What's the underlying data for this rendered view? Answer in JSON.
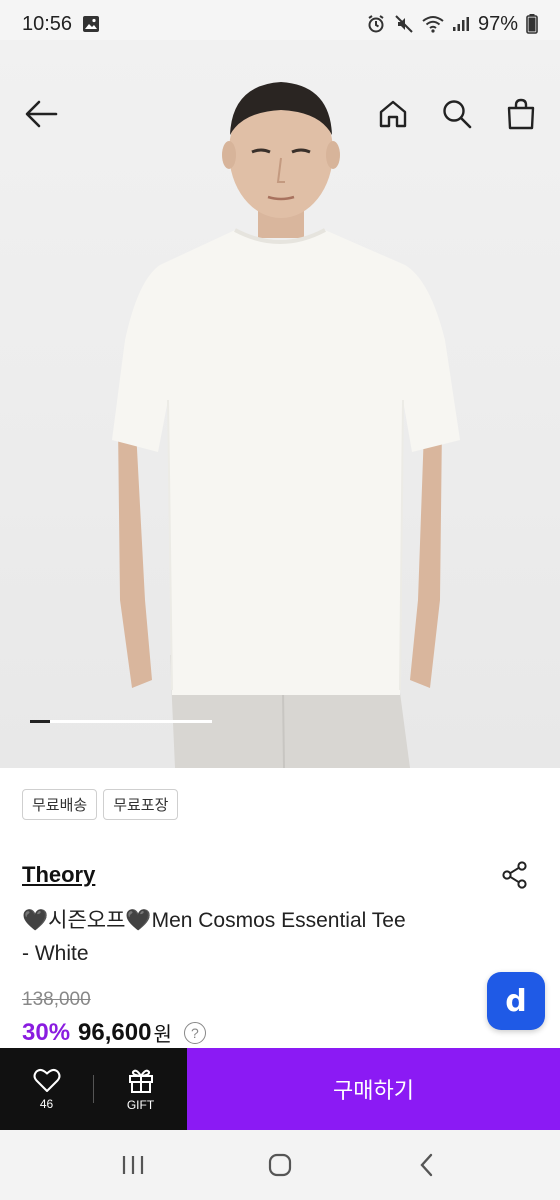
{
  "status_bar": {
    "time": "10:56",
    "battery": "97%"
  },
  "icons": {
    "back": "arrow-left-icon",
    "home": "home-icon",
    "search": "search-icon",
    "cart": "shopping-bag-icon",
    "share": "share-icon",
    "wishlist": "heart-icon",
    "gift": "gift-icon"
  },
  "tags": [
    "무료배송",
    "무료포장"
  ],
  "product": {
    "brand": "Theory",
    "title_line1": "🖤시즌오프🖤Men Cosmos Essential Tee",
    "title_line2": "- White",
    "original_price": "138,000",
    "discount": "30%",
    "price": "96,600",
    "currency": "원",
    "help": "?"
  },
  "badge": {
    "label": "d",
    "color": "#1f5ae6"
  },
  "carousel": {
    "current": 1,
    "total": 9
  },
  "action_bar": {
    "wishlist_count": "46",
    "gift_label": "GIFT",
    "buy_label": "구매하기",
    "buy_color": "#8b1af4"
  }
}
